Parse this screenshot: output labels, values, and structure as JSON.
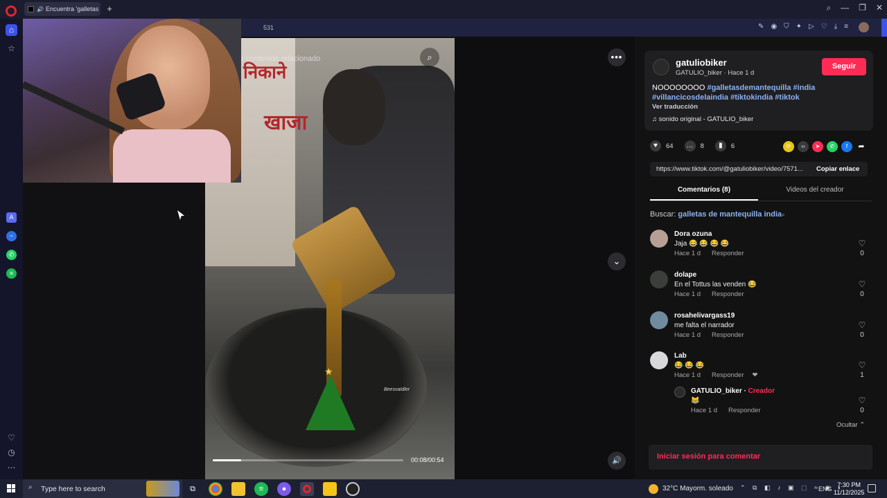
{
  "browser": {
    "tab_title": "Encuentra 'galletas de",
    "url_fragment": "531",
    "new_tab_label": "+",
    "window_controls": [
      "⌕",
      "—",
      "❐",
      "✕"
    ]
  },
  "sidebar_icons": [
    "home-icon",
    "star-icon",
    "aria-icon",
    "messenger-icon",
    "whatsapp-icon",
    "spotify-icon",
    "heart-icon",
    "history-icon",
    "more-icon"
  ],
  "video": {
    "related_text": "r contenido relacionado",
    "time": "00:08/00:54",
    "progress_fraction": 0.148,
    "watermark": "BeesvaIdler",
    "sign_text_1": "निकाने",
    "sign_text_2": "खाजा"
  },
  "post": {
    "username": "gatuliobiker",
    "subline": "GATULIO_biker · Hace 1 d",
    "follow_label": "Seguir",
    "desc_prefix": "NOOOOOOOO ",
    "hashtags_line1": "#galletasdemantequilla #india",
    "hashtags_line2": "#villancicosdelaindia #tiktokindia #tiktok",
    "translate_label": "Ver traducción",
    "sound": "♫  sonido original - GATULIO_biker",
    "likes": "64",
    "comments": "8",
    "saves": "6",
    "link": "https://www.tiktok.com/@gatuliobiker/video/7571...",
    "copy_label": "Copiar enlace"
  },
  "tabs": {
    "comments": "Comentarios (8)",
    "videos": "Videos del creador"
  },
  "search": {
    "prefix": "Buscar: ",
    "keyword": "galletas de mantequilla india"
  },
  "comments": [
    {
      "name": "Dora ozuna",
      "text": "Jaja 😂 😂 😂 😂",
      "time": "Hace 1 d",
      "reply": "Responder",
      "likes": "0"
    },
    {
      "name": "dolape",
      "text": "En el Tottus las venden 😂",
      "time": "Hace 1 d",
      "reply": "Responder",
      "likes": "0"
    },
    {
      "name": "rosahelivargass19",
      "text": "me falta el narrador",
      "time": "Hace 1 d",
      "reply": "Responder",
      "likes": "0"
    },
    {
      "name": "Lab",
      "text": "😂 😂 😂",
      "time": "Hace 1 d",
      "reply": "Responder",
      "likes": "1"
    }
  ],
  "reply": {
    "name": "GATULIO_biker",
    "creator_label": "Creador",
    "text": "😹",
    "time": "Hace 1 d",
    "reply": "Responder",
    "likes": "0"
  },
  "hide_label": "Ocultar ⌃",
  "login_prompt": "Iniciar sesión para comentar",
  "taskbar": {
    "search_placeholder": "Type here to search",
    "weather": "32°C  Mayorm. soleado",
    "lang": "ENG",
    "time": "7:30 PM",
    "date": "11/12/2025"
  },
  "colors": {
    "accent_pink": "#fe2c55",
    "hashtag_blue": "#8bb2f2",
    "opera_red": "#e0262c",
    "opera_blue": "#3d52e8"
  }
}
